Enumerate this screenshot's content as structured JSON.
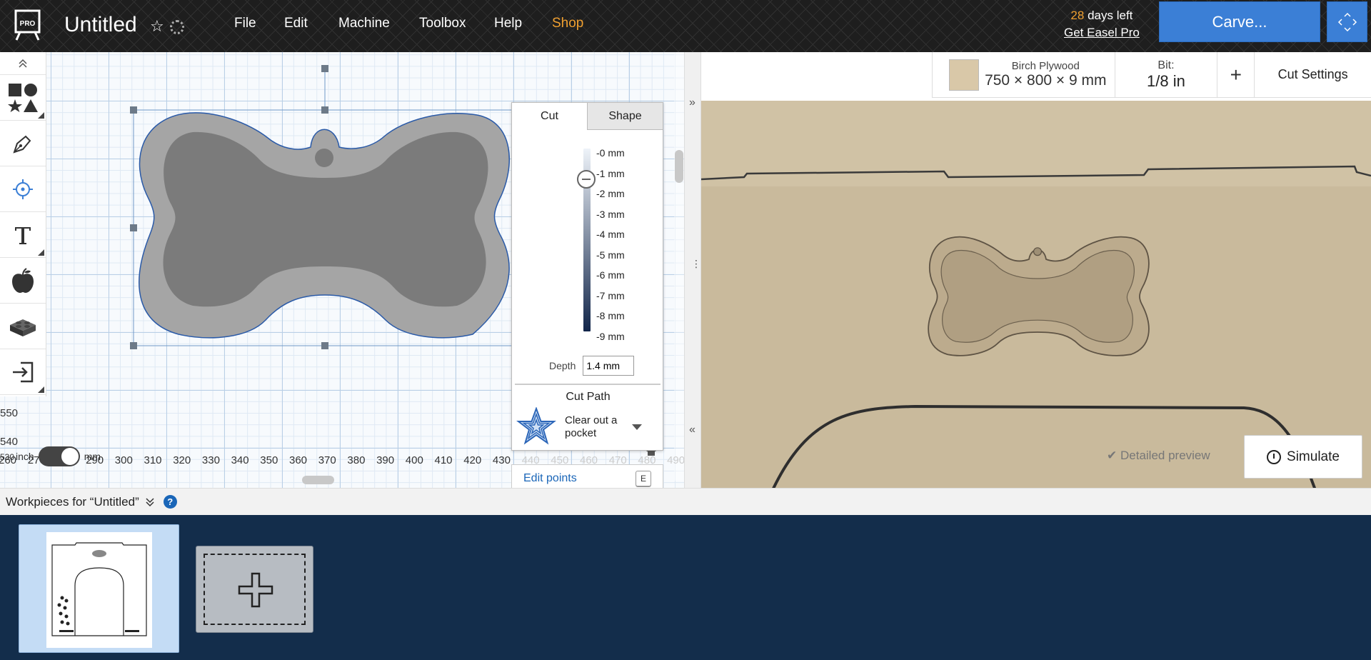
{
  "app": {
    "doc_title": "Untitled",
    "logo_text": "PRO"
  },
  "menu": [
    "File",
    "Edit",
    "Machine",
    "Toolbox",
    "Help",
    "Shop"
  ],
  "trial": {
    "days": "28",
    "days_suffix": "days left",
    "get_pro": "Get Easel Pro"
  },
  "carve_label": "Carve...",
  "toolbar_icons": [
    "shapes-icon",
    "pen-icon",
    "target-icon",
    "text-icon",
    "apple-icon",
    "lego-icon",
    "import-icon"
  ],
  "ruler_x": [
    "260",
    "270",
    "280",
    "290",
    "300",
    "310",
    "320",
    "330",
    "340",
    "350",
    "360",
    "370",
    "380",
    "390",
    "400",
    "410",
    "420",
    "430",
    "440",
    "450",
    "460",
    "470",
    "480",
    "490"
  ],
  "ruler_y": [
    "550",
    "540",
    "530"
  ],
  "units": {
    "left": "inch",
    "right": "mm"
  },
  "cut_panel": {
    "tab_cut": "Cut",
    "tab_shape": "Shape",
    "depth_scale": [
      "-0 mm",
      "-1 mm",
      "-2 mm",
      "-3 mm",
      "-4 mm",
      "-5 mm",
      "-6 mm",
      "-7 mm",
      "-8 mm",
      "-9 mm"
    ],
    "depth_label": "Depth",
    "depth_value": "1.4 mm",
    "cut_path_title": "Cut Path",
    "cut_path_value": "Clear out a pocket",
    "edit_points": "Edit points",
    "edit_points_key": "E"
  },
  "material": {
    "name": "Birch Plywood",
    "dimensions": "750 × 800 × 9 mm",
    "bit_label": "Bit:",
    "bit_value": "1/8 in",
    "add": "+",
    "cut_settings": "Cut Settings"
  },
  "preview": {
    "detailed_preview": "Detailed preview",
    "simulate": "Simulate"
  },
  "workpieces": {
    "header": "Workpieces for “Untitled”",
    "help": "?"
  },
  "colors": {
    "topbar": "#1e1e1e",
    "accent_blue": "#3b7fd6",
    "shop_orange": "#f0a030",
    "workpiece_bg": "#132d4b"
  }
}
